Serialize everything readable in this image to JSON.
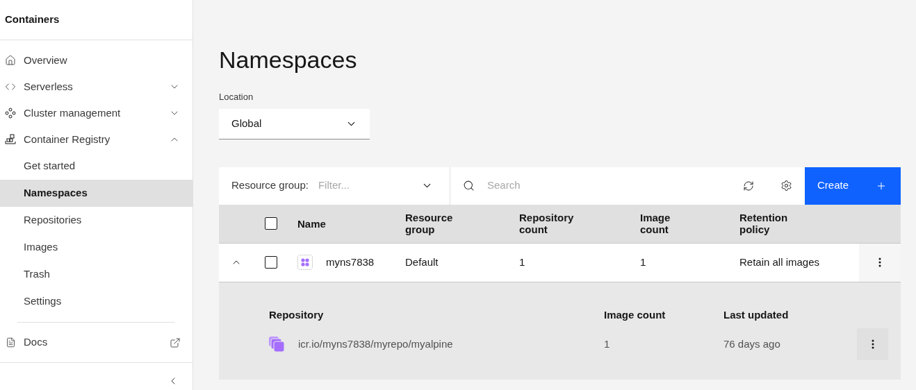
{
  "sidebar": {
    "title": "Containers",
    "items": [
      {
        "label": "Overview",
        "kind": "link"
      },
      {
        "label": "Serverless",
        "kind": "group",
        "expanded": false
      },
      {
        "label": "Cluster management",
        "kind": "group",
        "expanded": false
      },
      {
        "label": "Container Registry",
        "kind": "group",
        "expanded": true,
        "children": [
          {
            "label": "Get started",
            "selected": false
          },
          {
            "label": "Namespaces",
            "selected": true
          },
          {
            "label": "Repositories",
            "selected": false
          },
          {
            "label": "Images",
            "selected": false
          },
          {
            "label": "Trash",
            "selected": false
          },
          {
            "label": "Settings",
            "selected": false
          }
        ]
      }
    ],
    "docs": {
      "label": "Docs"
    }
  },
  "page": {
    "title": "Namespaces",
    "location": {
      "label": "Location",
      "value": "Global"
    }
  },
  "toolbar": {
    "filter_label": "Resource group:",
    "filter_placeholder": "Filter...",
    "search_placeholder": "Search",
    "create_label": "Create"
  },
  "table": {
    "select_all_checked": false,
    "columns": [
      "Name",
      "Resource group",
      "Repository count",
      "Image count",
      "Retention policy"
    ],
    "rows": [
      {
        "expanded": true,
        "checked": false,
        "cells": [
          "myns7838",
          "Default",
          "1",
          "1",
          "Retain all images"
        ],
        "detail": {
          "columns": [
            "Repository",
            "Image count",
            "Last updated"
          ],
          "rows": [
            {
              "cells": [
                "icr.io/myns7838/myrepo/myalpine",
                "1",
                "76 days ago"
              ]
            }
          ]
        }
      }
    ]
  }
}
